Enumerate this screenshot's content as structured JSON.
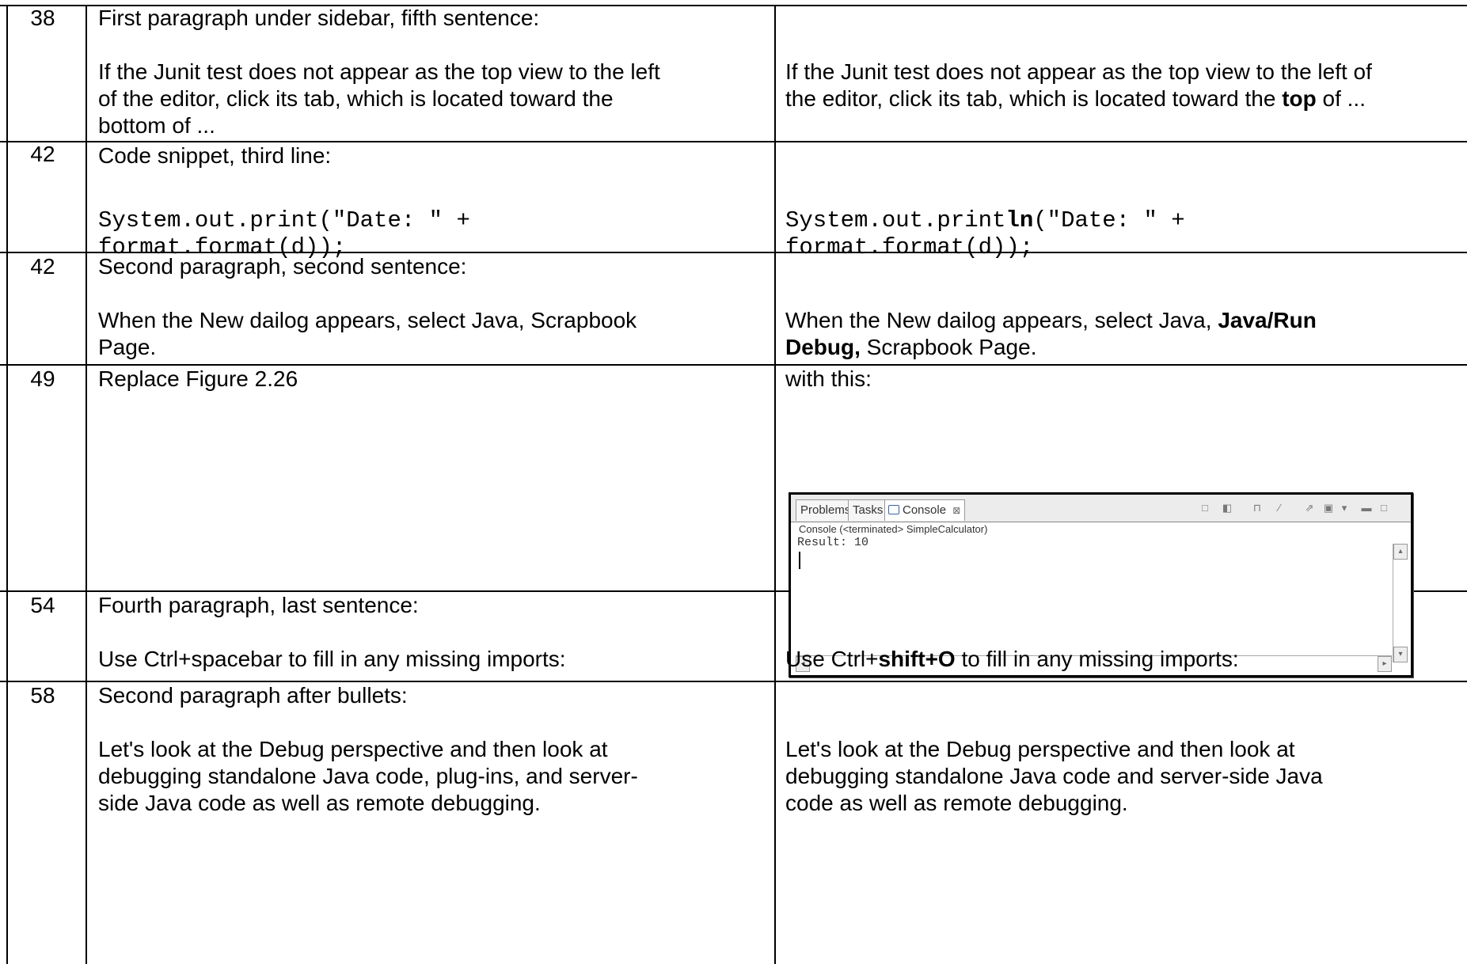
{
  "rows": [
    {
      "page": "38",
      "location": "First paragraph under sidebar, fifth sentence:",
      "original_lines": [
        "If the Junit test does not appear as the top view to the left",
        "of the editor, click its tab, which is located toward the",
        "bottom of ..."
      ],
      "corrected_line1": "If the Junit test does not appear as the top view to the left of",
      "corrected_line2_before": "the editor, click its tab, which is located toward the ",
      "corrected_line2_bold": "top",
      "corrected_line2_after": " of ..."
    },
    {
      "page": "42",
      "location": "Code snippet, third line:",
      "original_lines": [
        "System.out.print(\"Date: \" +",
        "format.format(d));"
      ],
      "corrected_line1_before": "System.out.print",
      "corrected_line1_bold": "ln",
      "corrected_line1_after": "(\"Date: \" +",
      "corrected_line2": "format.format(d));"
    },
    {
      "page": "42",
      "location": "Second paragraph, second sentence:",
      "original_lines": [
        "When the New dailog appears, select Java, Scrapbook",
        "Page."
      ],
      "corrected_line1_before": "When the New dailog appears, select Java, ",
      "corrected_line1_bold": "Java/Run",
      "corrected_line2_bold": "Debug,",
      "corrected_line2_after": " Scrapbook Page."
    },
    {
      "page": "49",
      "location": "Replace Figure 2.26",
      "corrected": "with this:",
      "console": {
        "tabs": [
          "Problems",
          "Tasks",
          "Console"
        ],
        "subhead": "Console (<terminated> SimpleCalculator)",
        "output": "Result: 10"
      }
    },
    {
      "page": "54",
      "location": "Fourth paragraph, last sentence:",
      "original": "Use Ctrl+spacebar to fill in any missing imports:",
      "corrected_before": "Use Ctrl+",
      "corrected_bold": "shift+O",
      "corrected_after": " to fill in any missing imports:"
    },
    {
      "page": "58",
      "location": "Second paragraph after bullets:",
      "original_lines": [
        "Let's look at the Debug perspective and then look at",
        "debugging standalone Java code, plug-ins, and server-",
        "side Java code as well as remote debugging."
      ],
      "corrected_lines": [
        "Let's look at the Debug perspective and then look at",
        "debugging standalone Java code and server-side Java",
        "code as well as remote debugging."
      ]
    }
  ]
}
